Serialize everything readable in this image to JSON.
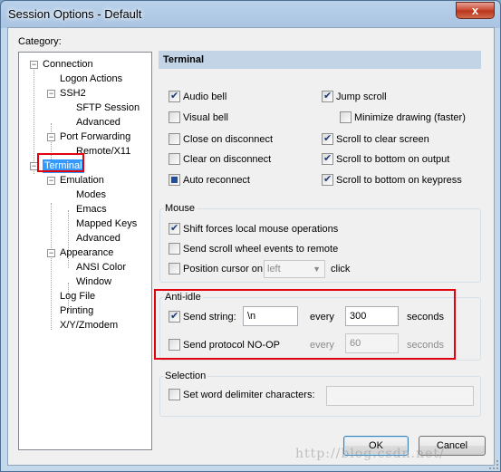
{
  "window": {
    "title": "Session Options - Default",
    "close_glyph": "x"
  },
  "category": {
    "label": "Category:",
    "items": [
      {
        "label": "Connection",
        "expander": "−"
      },
      {
        "label": "Logon Actions"
      },
      {
        "label": "SSH2",
        "expander": "−"
      },
      {
        "label": "SFTP Session"
      },
      {
        "label": "Advanced"
      },
      {
        "label": "Port Forwarding",
        "expander": "−"
      },
      {
        "label": "Remote/X11"
      },
      {
        "label": "Terminal",
        "expander": "−",
        "selected": true
      },
      {
        "label": "Emulation",
        "expander": "−"
      },
      {
        "label": "Modes"
      },
      {
        "label": "Emacs"
      },
      {
        "label": "Mapped Keys"
      },
      {
        "label": "Advanced"
      },
      {
        "label": "Appearance",
        "expander": "−"
      },
      {
        "label": "ANSI Color"
      },
      {
        "label": "Window"
      },
      {
        "label": "Log File"
      },
      {
        "label": "Printing"
      },
      {
        "label": "X/Y/Zmodem"
      }
    ]
  },
  "panel": {
    "header": "Terminal",
    "options_left": [
      {
        "label": "Audio bell",
        "checked": true
      },
      {
        "label": "Visual bell",
        "checked": false
      },
      {
        "label": "Close on disconnect",
        "checked": false
      },
      {
        "label": "Clear on disconnect",
        "checked": false
      },
      {
        "label": "Auto reconnect",
        "checked": "indeterminate"
      }
    ],
    "options_right": [
      {
        "label": "Jump scroll",
        "checked": true
      },
      {
        "label": "Minimize drawing (faster)",
        "checked": false
      },
      {
        "label": "Scroll to clear screen",
        "checked": true
      },
      {
        "label": "Scroll to bottom on output",
        "checked": true
      },
      {
        "label": "Scroll to bottom on keypress",
        "checked": true
      }
    ],
    "mouse": {
      "title": "Mouse",
      "shift": {
        "label": "Shift forces local mouse operations",
        "checked": true
      },
      "wheel": {
        "label": "Send scroll wheel events to remote",
        "checked": false
      },
      "position": {
        "label": "Position cursor on",
        "checked": false,
        "select_value": "left",
        "suffix": "click"
      }
    },
    "anti_idle": {
      "title": "Anti-idle",
      "send_string": {
        "label": "Send string:",
        "checked": true,
        "value": "\\n",
        "every_label": "every",
        "seconds_value": "300",
        "seconds_label": "seconds"
      },
      "send_noop": {
        "label": "Send protocol NO-OP",
        "checked": false,
        "every_label": "every",
        "seconds_value": "60",
        "seconds_label": "seconds"
      }
    },
    "selection": {
      "title": "Selection",
      "delimiter": {
        "label": "Set word delimiter characters:",
        "checked": false,
        "value": ""
      }
    }
  },
  "buttons": {
    "ok": "OK",
    "cancel": "Cancel"
  },
  "watermark": "http://blog.csdn.net/",
  "colors": {
    "selection": "#3399ff",
    "highlight_box": "#e3000f",
    "header_bar": "#c3d4e7"
  }
}
